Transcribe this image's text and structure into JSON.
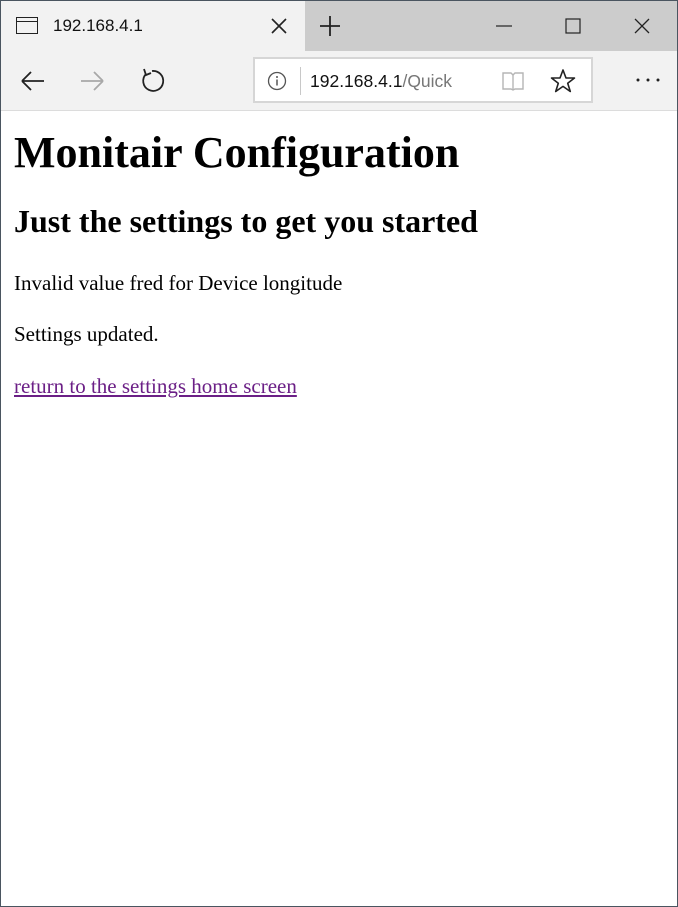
{
  "tab": {
    "title": "192.168.4.1"
  },
  "address": {
    "host": "192.168.4.1",
    "path": "/Quick"
  },
  "page": {
    "title": "Monitair Configuration",
    "subtitle": "Just the settings to get you started",
    "messages": {
      "invalid": "Invalid value fred for Device longitude",
      "updated": "Settings updated."
    },
    "home_link": "return to the settings home screen"
  },
  "colors": {
    "link_visited": "#6b1f86",
    "chrome_bg": "#f2f2f2",
    "tabstrip_bg": "#cccccc"
  }
}
